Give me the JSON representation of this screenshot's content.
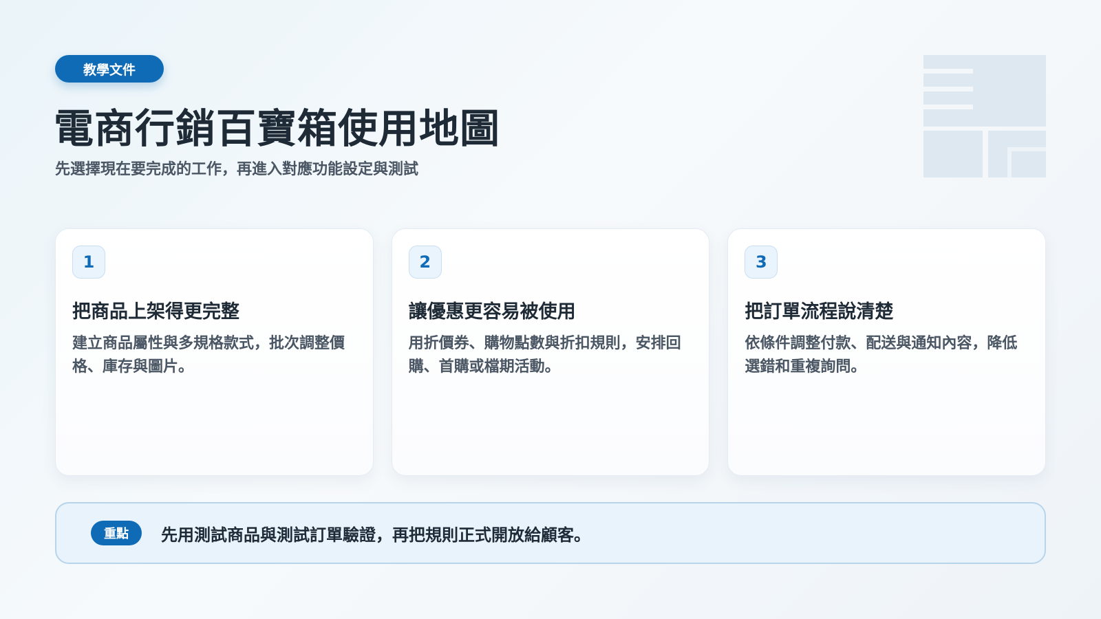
{
  "header": {
    "badge": "教學文件",
    "title": "電商行銷百寶箱使用地圖",
    "subtitle": "先選擇現在要完成的工作，再進入對應功能設定與測試"
  },
  "decor": {
    "icon": "layout-grid-icon",
    "color": "#dde8f1"
  },
  "cards": [
    {
      "number": "1",
      "title": "把商品上架得更完整",
      "description": "建立商品屬性與多規格款式，批次調整價格、庫存與圖片。"
    },
    {
      "number": "2",
      "title": "讓優惠更容易被使用",
      "description": "用折價券、購物點數與折扣規則，安排回購、首購或檔期活動。"
    },
    {
      "number": "3",
      "title": "把訂單流程說清楚",
      "description": "依條件調整付款、配送與通知內容，降低選錯和重複詢問。"
    }
  ],
  "note": {
    "badge": "重點",
    "text": "先用測試商品與測試訂單驗證，再把規則正式開放給顧客。"
  },
  "colors": {
    "accent": "#0f6bb5",
    "title": "#1e2a36",
    "note_bg": "#e8f3fc"
  }
}
